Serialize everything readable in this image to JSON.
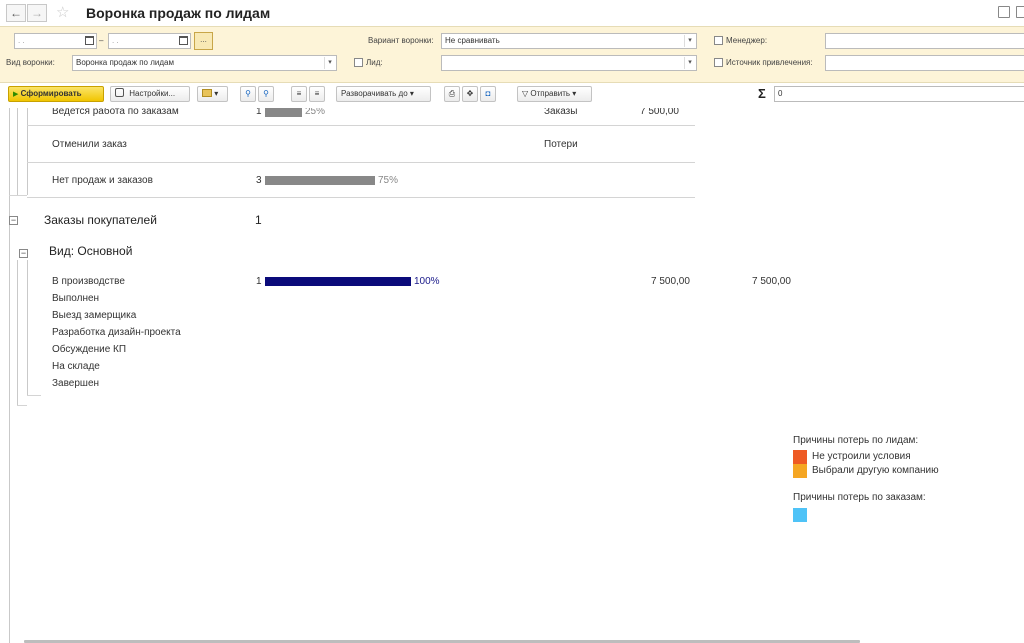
{
  "window": {
    "title": "Воронка продаж по лидам",
    "back": "←",
    "forward": "→",
    "star": "☆"
  },
  "filters": {
    "date_from_placeholder": ". .",
    "date_dash": "–",
    "date_to_placeholder": ". .",
    "more_btn": "...",
    "variant_label": "Вариант воронки:",
    "variant_value": "Не сравнивать",
    "manager_label": "Менеджер:",
    "funnel_type_label": "Вид воронки:",
    "funnel_type_value": "Воронка продаж по лидам",
    "lead_label": "Лид:",
    "source_label": "Источник привлечения:"
  },
  "toolbar": {
    "run_label": "Сформировать",
    "run_icon": "▶",
    "settings_label": "Настройки...",
    "expand_label": "Разворачивать до",
    "send_label": "Отправить",
    "sigma": "Σ",
    "sum_value": "0"
  },
  "report": {
    "top_rows": [
      {
        "name": "Ведется работа по заказам",
        "count": "1",
        "bar_fraction": 0.25,
        "pct": "25%",
        "category": "Заказы",
        "amount": "7 500,00"
      },
      {
        "name": "Отменили заказ",
        "count": "",
        "bar_fraction": 0,
        "pct": "",
        "category": "Потери",
        "amount": ""
      },
      {
        "name": "Нет продаж и заказов",
        "count": "3",
        "bar_fraction": 0.75,
        "pct": "75%",
        "category": "",
        "amount": ""
      }
    ],
    "group_title": "Заказы покупателей",
    "group_count": "1",
    "subgroup_title": "Вид: Основной",
    "status_rows": [
      {
        "name": "В производстве",
        "count": "1",
        "bar_fraction": 1.0,
        "pct": "100%",
        "amount": "7 500,00",
        "amount2": "7 500,00"
      },
      {
        "name": "Выполнен"
      },
      {
        "name": "Выезд замерщика"
      },
      {
        "name": "Разработка дизайн-проекта"
      },
      {
        "name": "Обсуждение КП"
      },
      {
        "name": "На складе"
      },
      {
        "name": "Завершен"
      }
    ],
    "legend_leads_title": "Причины потерь по лидам:",
    "legend_leads": [
      {
        "label": "Не устроили условия",
        "color": "#ee5a24"
      },
      {
        "label": "Выбрали другую компанию",
        "color": "#f5a623"
      }
    ],
    "legend_orders_title": "Причины потерь по заказам:",
    "legend_orders": [
      {
        "label": "",
        "color": "#4fc3f7"
      }
    ]
  },
  "colors": {
    "bar_gray": "#888888",
    "bar_blue": "#0b0b7a",
    "filter_bg": "#fdf4d8"
  }
}
